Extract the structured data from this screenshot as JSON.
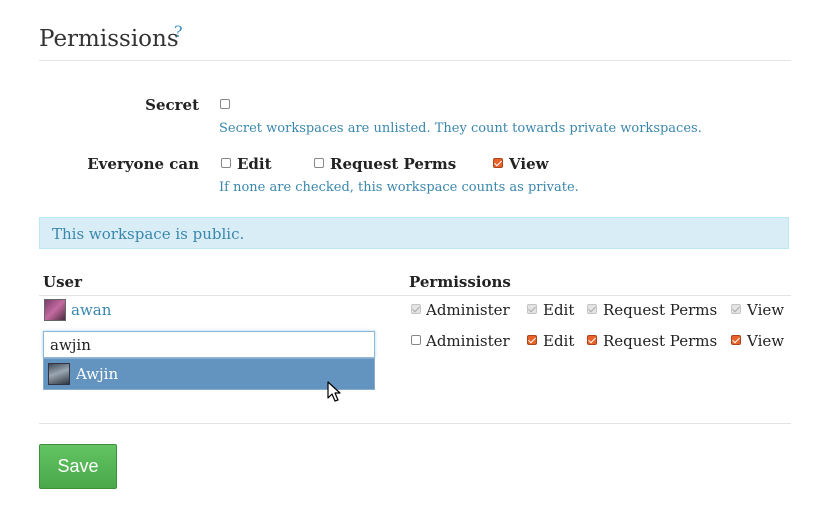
{
  "header": {
    "title": "Permissions",
    "help": "?"
  },
  "secret": {
    "label": "Secret",
    "checked": false,
    "hint": "Secret workspaces are unlisted. They count towards private workspaces."
  },
  "everyone": {
    "label": "Everyone can",
    "options": [
      {
        "label": "Edit",
        "checked": false
      },
      {
        "label": "Request Perms",
        "checked": false
      },
      {
        "label": "View",
        "checked": true
      }
    ],
    "hint": "If none are checked, this workspace counts as private."
  },
  "alert": {
    "text": "This workspace is public."
  },
  "table": {
    "col_user": "User",
    "col_permissions": "Permissions",
    "rows": [
      {
        "user": "awan",
        "perms": [
          {
            "label": "Administer",
            "checked": true,
            "disabled": true
          },
          {
            "label": "Edit",
            "checked": true,
            "disabled": true
          },
          {
            "label": "Request Perms",
            "checked": true,
            "disabled": true
          },
          {
            "label": "View",
            "checked": true,
            "disabled": true
          }
        ]
      },
      {
        "input_value": "awjin",
        "perms": [
          {
            "label": "Administer",
            "checked": false,
            "disabled": false
          },
          {
            "label": "Edit",
            "checked": true,
            "disabled": false
          },
          {
            "label": "Request Perms",
            "checked": true,
            "disabled": false
          },
          {
            "label": "View",
            "checked": true,
            "disabled": false
          }
        ]
      }
    ]
  },
  "autocomplete": {
    "suggestion": "Awjin"
  },
  "save_label": "Save",
  "colors": {
    "accent": "#3a87ad",
    "checkbox_checked": "#e8622a",
    "save_green": "#5bb75b",
    "dropdown_highlight": "#6393bf"
  }
}
